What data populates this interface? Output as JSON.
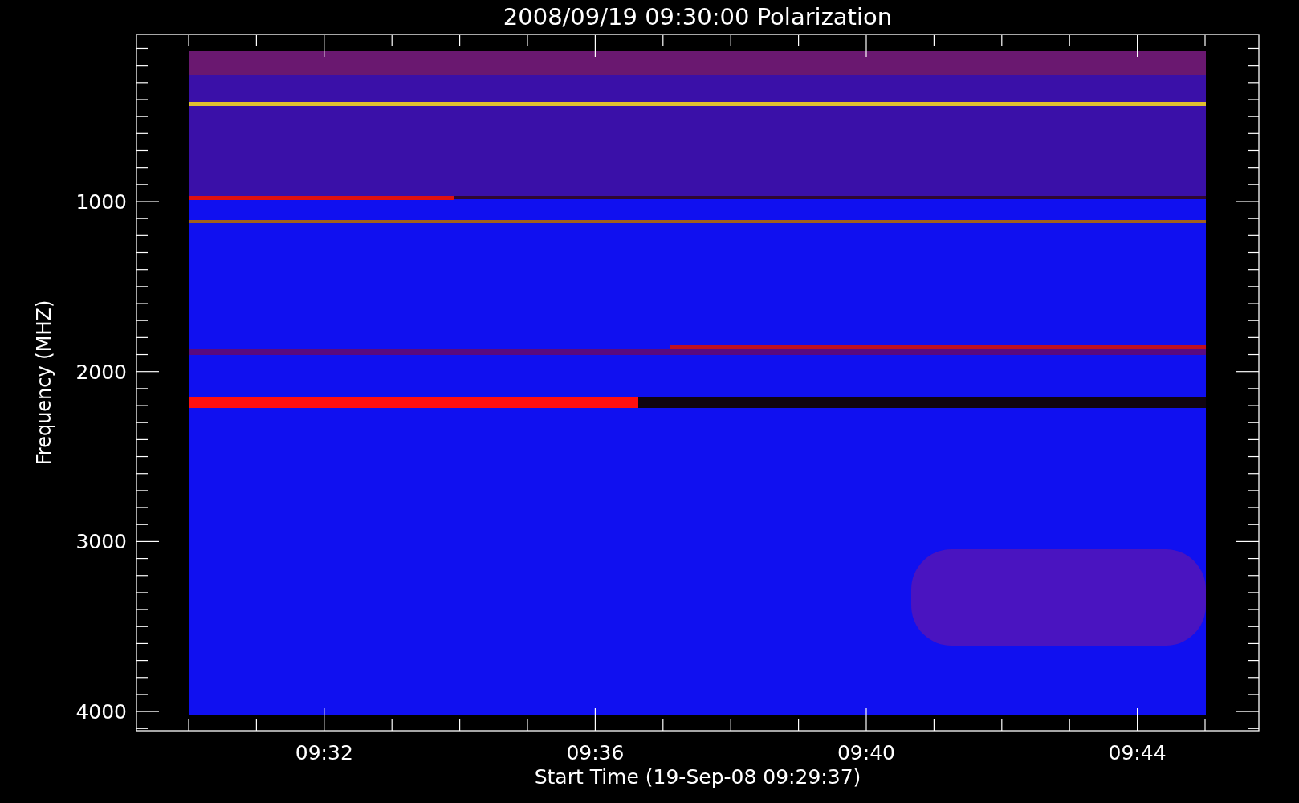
{
  "title": "2008/09/19 09:30:00 Polarization",
  "y_axis": {
    "label": "Frequency (MHZ)",
    "tick_labels": [
      "1000",
      "2000",
      "3000",
      "4000"
    ]
  },
  "x_axis": {
    "label": "Start Time (19-Sep-08 09:29:37)",
    "tick_labels": [
      "09:32",
      "09:36",
      "09:40",
      "09:44"
    ]
  }
}
